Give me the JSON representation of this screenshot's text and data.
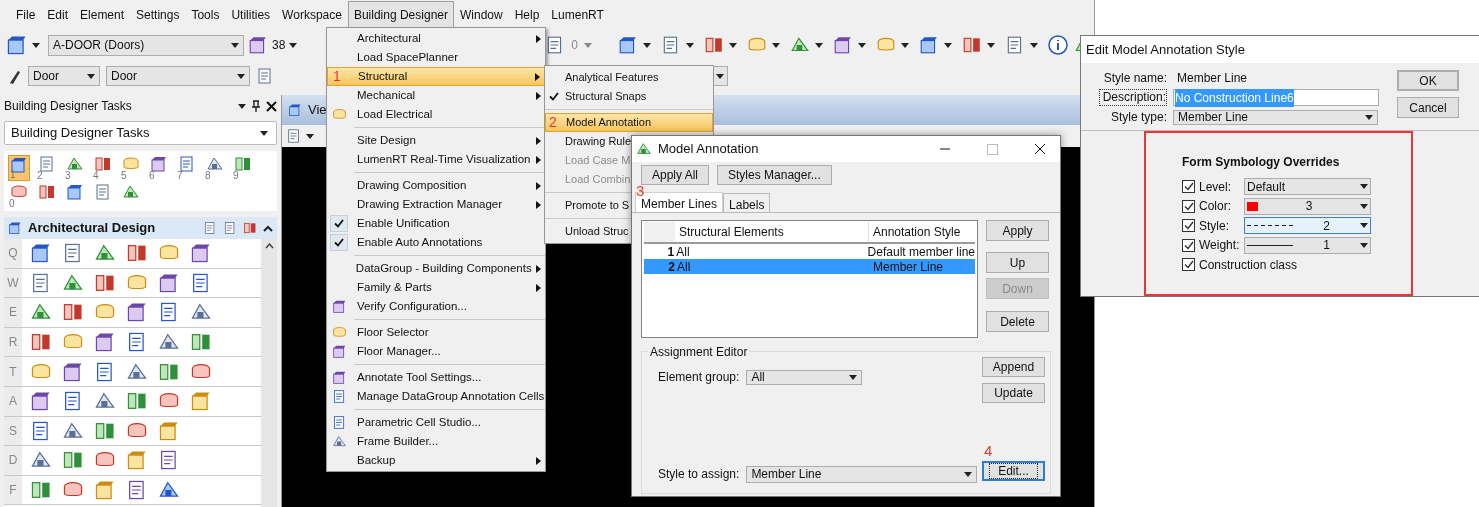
{
  "menu_bar": [
    {
      "label": "File",
      "selected": false
    },
    {
      "label": "Edit",
      "selected": false
    },
    {
      "label": "Element",
      "selected": false
    },
    {
      "label": "Settings",
      "selected": false
    },
    {
      "label": "Tools",
      "selected": false
    },
    {
      "label": "Utilities",
      "selected": false
    },
    {
      "label": "Workspace",
      "selected": false
    },
    {
      "label": "Building Designer",
      "selected": true
    },
    {
      "label": "Window",
      "selected": false
    },
    {
      "label": "Help",
      "selected": false
    },
    {
      "label": "LumenRT",
      "selected": false
    }
  ],
  "toolbar_top": {
    "level": "A-DOOR (Doors)",
    "level_count": "38",
    "count": "0"
  },
  "toolbar_attributes": {
    "family": "Door",
    "part": "Door"
  },
  "tasks_panel": {
    "title": "Building Designer Tasks",
    "task_set": "Building Designer Tasks",
    "tools": [
      {
        "number": "1",
        "selected": true
      },
      {
        "number": "2",
        "selected": false
      },
      {
        "number": "3",
        "selected": false
      },
      {
        "number": "4",
        "selected": false
      },
      {
        "number": "5",
        "selected": false
      },
      {
        "number": "6",
        "selected": false
      },
      {
        "number": "7",
        "selected": false
      },
      {
        "number": "8",
        "selected": false
      },
      {
        "number": "9",
        "selected": false
      },
      {
        "number": "0",
        "selected": false
      }
    ],
    "section": "Architectural Design",
    "rows": [
      {
        "key": "Q"
      },
      {
        "key": "W"
      },
      {
        "key": "E"
      },
      {
        "key": "R"
      },
      {
        "key": "T"
      },
      {
        "key": "A"
      },
      {
        "key": "S"
      },
      {
        "key": "D"
      },
      {
        "key": "F"
      }
    ]
  },
  "view": {
    "title": "Vie"
  },
  "building_designer_menu": {
    "groups": [
      [
        {
          "label": "Architectural",
          "submenu": true,
          "checked": false,
          "icon": false,
          "selected": false
        },
        {
          "label": "Load SpacePlanner",
          "submenu": false,
          "checked": false,
          "icon": false,
          "selected": false
        },
        {
          "label": "Structural",
          "submenu": true,
          "checked": false,
          "icon": false,
          "selected": true,
          "marker": "1"
        },
        {
          "label": "Mechanical",
          "submenu": true,
          "checked": false,
          "icon": false,
          "selected": false
        },
        {
          "label": "Load Electrical",
          "submenu": false,
          "checked": false,
          "icon": true,
          "selected": false
        }
      ],
      [
        {
          "label": "Site Design",
          "submenu": true,
          "checked": false,
          "icon": false,
          "selected": false
        },
        {
          "label": "LumenRT Real-Time Visualization",
          "submenu": true,
          "checked": false,
          "icon": false,
          "selected": false
        }
      ],
      [
        {
          "label": "Drawing Composition",
          "submenu": true,
          "checked": false,
          "icon": false,
          "selected": false
        },
        {
          "label": "Drawing Extraction Manager",
          "submenu": true,
          "checked": false,
          "icon": false,
          "selected": false
        },
        {
          "label": "Enable Unification",
          "submenu": false,
          "checked": true,
          "icon": false,
          "selected": false
        },
        {
          "label": "Enable Auto Annotations",
          "submenu": false,
          "checked": true,
          "icon": false,
          "selected": false
        }
      ],
      [
        {
          "label": "DataGroup - Building Components",
          "submenu": true,
          "checked": false,
          "icon": false,
          "selected": false
        },
        {
          "label": "Family & Parts",
          "submenu": true,
          "checked": false,
          "icon": false,
          "selected": false
        },
        {
          "label": "Verify Configuration...",
          "submenu": false,
          "checked": false,
          "icon": true,
          "selected": false
        }
      ],
      [
        {
          "label": "Floor Selector",
          "submenu": false,
          "checked": false,
          "icon": true,
          "selected": false
        },
        {
          "label": "Floor Manager...",
          "submenu": false,
          "checked": false,
          "icon": true,
          "selected": false
        }
      ],
      [
        {
          "label": "Annotate Tool Settings...",
          "submenu": false,
          "checked": false,
          "icon": true,
          "selected": false
        },
        {
          "label": "Manage DataGroup Annotation Cells",
          "submenu": false,
          "checked": false,
          "icon": true,
          "selected": false
        }
      ],
      [
        {
          "label": "Parametric Cell Studio...",
          "submenu": false,
          "checked": false,
          "icon": true,
          "selected": false
        },
        {
          "label": "Frame Builder...",
          "submenu": false,
          "checked": false,
          "icon": true,
          "selected": false
        },
        {
          "label": "Backup",
          "submenu": true,
          "checked": false,
          "icon": false,
          "selected": false
        }
      ]
    ]
  },
  "structural_submenu": {
    "groups": [
      [
        {
          "label": "Analytical Features",
          "checked": false,
          "selected": false,
          "disabled": false
        },
        {
          "label": "Structural Snaps",
          "checked": true,
          "selected": false,
          "disabled": false
        }
      ],
      [
        {
          "label": "Model Annotation",
          "checked": false,
          "selected": true,
          "disabled": false,
          "marker": "2"
        },
        {
          "label": "Drawing Rule",
          "checked": false,
          "selected": false,
          "disabled": false
        },
        {
          "label": "Load Case M",
          "checked": false,
          "selected": false,
          "disabled": true
        },
        {
          "label": "Load Combin",
          "checked": false,
          "selected": false,
          "disabled": true
        }
      ],
      [
        {
          "label": "Promote to S",
          "checked": false,
          "selected": false,
          "disabled": false
        }
      ],
      [
        {
          "label": "Unload Struc",
          "checked": false,
          "selected": false,
          "disabled": false
        }
      ]
    ]
  },
  "model_annotation_dialog": {
    "title": "Model Annotation",
    "top_buttons": [
      "Apply All",
      "Styles Manager..."
    ],
    "tabs": [
      {
        "label": "Member Lines",
        "selected": true,
        "marker": "3"
      },
      {
        "label": "Labels",
        "selected": false
      }
    ],
    "columns": [
      "Structural Elements",
      "Annotation Style"
    ],
    "rows": [
      {
        "index": "1",
        "element": "All",
        "style": "Default member line",
        "selected": false
      },
      {
        "index": "2",
        "element": "All",
        "style": "Member Line",
        "selected": true
      }
    ],
    "side_buttons": [
      {
        "label": "Apply",
        "disabled": false
      },
      {
        "label": "Up",
        "disabled": false
      },
      {
        "label": "Down",
        "disabled": true
      },
      {
        "label": "Delete",
        "disabled": false
      }
    ],
    "group_title": "Assignment Editor",
    "element_group_label": "Element group:",
    "element_group": "All",
    "group_buttons": [
      "Append",
      "Update"
    ],
    "style_label": "Style to assign:",
    "style": "Member Line",
    "edit_button": "Edit...",
    "edit_marker": "4"
  },
  "edit_style_dialog": {
    "title": "Edit Model Annotation Style",
    "style_name_label": "Style name:",
    "style_name": "Member Line",
    "description_label": "Description:",
    "description": "No Construction Line6",
    "style_type_label": "Style type:",
    "style_type": "Member Line",
    "buttons": [
      "OK",
      "Cancel"
    ],
    "group_title": "Form Symbology Overrides",
    "overrides": [
      {
        "kind": "plain",
        "label": "Level:",
        "value": "Default",
        "checked": true,
        "focused": false
      },
      {
        "kind": "color",
        "label": "Color:",
        "value": "3",
        "color": "#ff0000",
        "checked": true,
        "focused": false
      },
      {
        "kind": "dashed",
        "label": "Style:",
        "value": "2",
        "checked": true,
        "focused": true
      },
      {
        "kind": "solid",
        "label": "Weight:",
        "value": "1",
        "checked": true,
        "focused": false
      },
      {
        "kind": "check",
        "label": "Construction class",
        "checked": true
      }
    ]
  }
}
